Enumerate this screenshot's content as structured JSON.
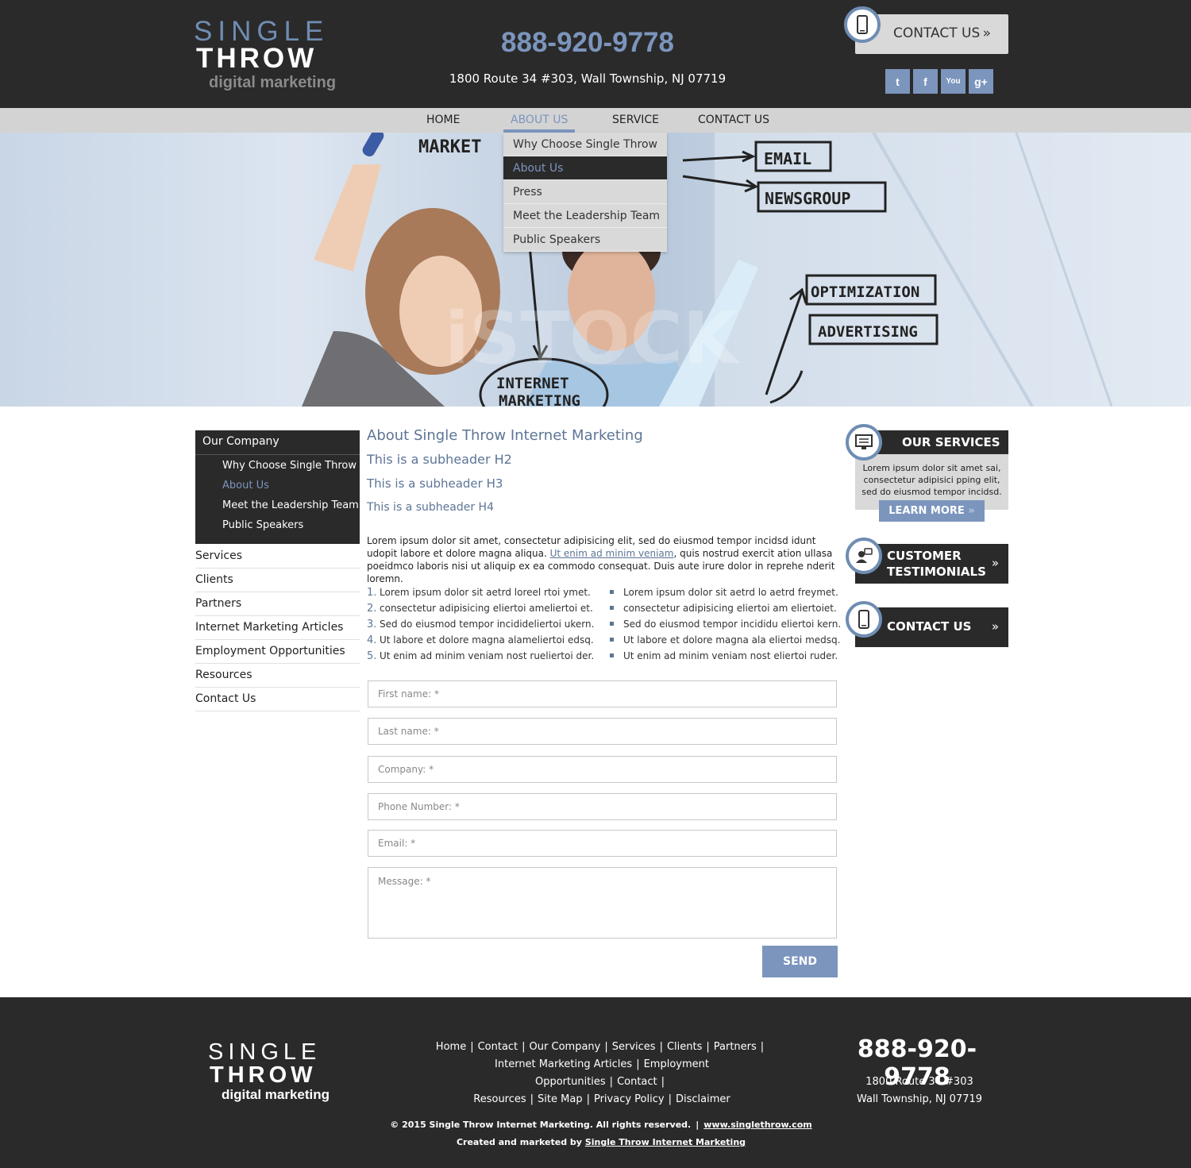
{
  "header": {
    "logo": {
      "line1": "SINGLE",
      "line2": "THROW",
      "line3": "digital marketing"
    },
    "phone": "888-920-9778",
    "address": "1800 Route 34 #303, Wall Township, NJ 07719",
    "contact_button": "CONTACT US",
    "chevron": "»",
    "social": [
      "twitter-icon",
      "facebook-icon",
      "youtube-icon",
      "google-plus-icon"
    ],
    "social_glyphs": [
      "t",
      "f",
      "You",
      "g+"
    ]
  },
  "nav": {
    "items": [
      "HOME",
      "ABOUT US",
      "SERVICE",
      "CONTACT US"
    ],
    "active": "ABOUT US",
    "dropdown": [
      "Why Choose Single Throw",
      "About Us",
      "Press",
      "Meet the Leadership Team",
      "Public Speakers"
    ],
    "dropdown_selected": "About Us"
  },
  "hero": {
    "labels": [
      "MARKET",
      "EMAIL",
      "NEWSGROUP",
      "OPTIMIZATION",
      "ADVERTISING",
      "INTERNET",
      "MARKETING"
    ],
    "watermark": "iSTOCK"
  },
  "left_sidebar": {
    "heading": "Our Company",
    "sub_items": [
      "Why Choose Single Throw",
      "About Us",
      "Meet the Leadership Team",
      "Public Speakers"
    ],
    "sub_selected": "About Us",
    "links": [
      "Services",
      "Clients",
      "Partners",
      "Internet Marketing Articles",
      "Employment Opportunities",
      "Resources",
      "Contact Us"
    ]
  },
  "main": {
    "h1": "About Single Throw Internet Marketing",
    "h2": "This is a subheader H2",
    "h3": "This is a subheader H3",
    "h4": "This is a subheader H4",
    "para_before": "Lorem ipsum dolor sit amet, consectetur adipisicing elit, sed do eiusmod tempor incidsd idunt udopit labore et dolore magna aliqua. ",
    "para_link": "Ut enim ad minim veniam",
    "para_after": ", quis nostrud exercit ation ullasa poeidmco laboris nisi ut aliquip ex ea commodo consequat. Duis aute irure dolor in reprehe nderit loremn.",
    "ordered_list": [
      "Lorem ipsum dolor sit aetrd loreel rtoi  ymet.",
      "consectetur adipisicing eliertoi ameliertoi et.",
      "Sed do eiusmod tempor incidideliertoi ukern.",
      "Ut labore et dolore magna alameliertoi edsq.",
      "Ut enim ad minim veniam nost rueliertoi der."
    ],
    "ordered_numbers": [
      "1.",
      "2.",
      "3.",
      "4.",
      "5."
    ],
    "bullet_list": [
      "Lorem ipsum dolor sit aetrd lo aetrd freymet.",
      "consectetur adipisicing eliertoi am eliertoiet.",
      "Sed do eiusmod tempor incididu eliertoi kern.",
      "Ut labore et dolore magna ala eliertoi medsq.",
      "Ut enim ad minim veniam nost eliertoi ruder."
    ]
  },
  "form": {
    "first_name": "First name: *",
    "last_name": "Last name: *",
    "company": "Company: *",
    "phone": "Phone Number: *",
    "email": "Email: *",
    "message": "Message: *",
    "send": "SEND"
  },
  "right_sidebar": {
    "services_title": "OUR SERVICES",
    "services_text": "Lorem ipsum dolor sit amet sai, consectetur adipisici pping elit, sed do eiusmod tempor incidsd.",
    "learn_more": "LEARN MORE",
    "learn_more_chevron": "»",
    "testimonials_line1": "CUSTOMER",
    "testimonials_line2": "TESTIMONIALS",
    "contact": "CONTACT US",
    "chevron": "»"
  },
  "footer": {
    "logo": {
      "line1": "SINGLE",
      "line2": "THROW",
      "line3": "digital marketing"
    },
    "links_row1": [
      "Home",
      "Contact",
      "Our Company",
      "Services",
      "Clients",
      "Partners"
    ],
    "links_row2": [
      "Internet Marketing Articles",
      "Employment Opportunities",
      "Contact"
    ],
    "links_row3": [
      "Resources",
      "Site Map",
      "Privacy Policy",
      "Disclaimer"
    ],
    "separator": "|",
    "phone": "888-920-9778",
    "address_line1": "1800 Route 34 #303",
    "address_line2": "Wall Township, NJ 07719",
    "copyright": "© 2015 Single Throw Internet Marketing. All rights reserved.",
    "website": "www.singlethrow.com",
    "created_by": "Created and marketed by ",
    "created_link": "Single Throw Internet Marketing"
  },
  "colors": {
    "dark": "#2b2a2a",
    "accent": "#7b95bd",
    "light_gray": "#d9d9d9",
    "heading": "#5d7596"
  }
}
